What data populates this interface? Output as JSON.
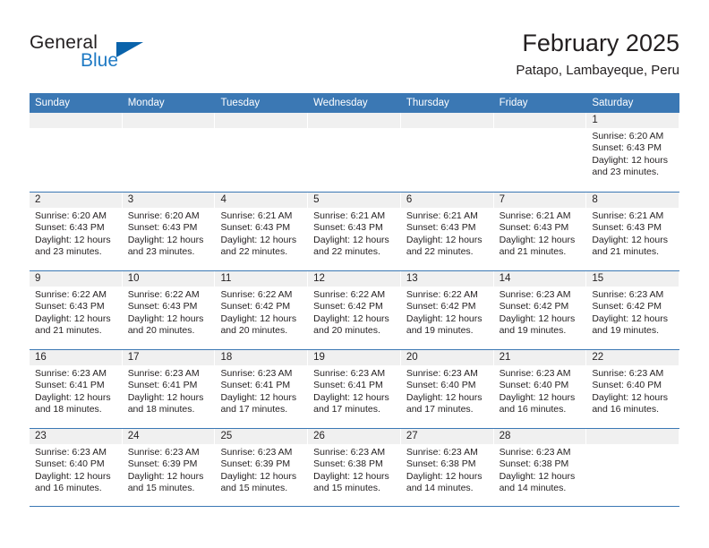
{
  "brand": {
    "name_part1": "General",
    "name_part2": "Blue",
    "accent_color": "#0a63ab",
    "blue_text_color": "#1f7ac4"
  },
  "header": {
    "title": "February 2025",
    "subtitle": "Patapo, Lambayeque, Peru"
  },
  "calendar": {
    "header_bg": "#3b78b4",
    "weekday_headers": [
      "Sunday",
      "Monday",
      "Tuesday",
      "Wednesday",
      "Thursday",
      "Friday",
      "Saturday"
    ],
    "weeks": [
      [
        {
          "day": "",
          "empty": true,
          "sunrise": "",
          "sunset": "",
          "daylight_line1": "",
          "daylight_line2": ""
        },
        {
          "day": "",
          "empty": true,
          "sunrise": "",
          "sunset": "",
          "daylight_line1": "",
          "daylight_line2": ""
        },
        {
          "day": "",
          "empty": true,
          "sunrise": "",
          "sunset": "",
          "daylight_line1": "",
          "daylight_line2": ""
        },
        {
          "day": "",
          "empty": true,
          "sunrise": "",
          "sunset": "",
          "daylight_line1": "",
          "daylight_line2": ""
        },
        {
          "day": "",
          "empty": true,
          "sunrise": "",
          "sunset": "",
          "daylight_line1": "",
          "daylight_line2": ""
        },
        {
          "day": "",
          "empty": true,
          "sunrise": "",
          "sunset": "",
          "daylight_line1": "",
          "daylight_line2": ""
        },
        {
          "day": "1",
          "sunrise": "Sunrise: 6:20 AM",
          "sunset": "Sunset: 6:43 PM",
          "daylight_line1": "Daylight: 12 hours",
          "daylight_line2": "and 23 minutes."
        }
      ],
      [
        {
          "day": "2",
          "sunrise": "Sunrise: 6:20 AM",
          "sunset": "Sunset: 6:43 PM",
          "daylight_line1": "Daylight: 12 hours",
          "daylight_line2": "and 23 minutes."
        },
        {
          "day": "3",
          "sunrise": "Sunrise: 6:20 AM",
          "sunset": "Sunset: 6:43 PM",
          "daylight_line1": "Daylight: 12 hours",
          "daylight_line2": "and 23 minutes."
        },
        {
          "day": "4",
          "sunrise": "Sunrise: 6:21 AM",
          "sunset": "Sunset: 6:43 PM",
          "daylight_line1": "Daylight: 12 hours",
          "daylight_line2": "and 22 minutes."
        },
        {
          "day": "5",
          "sunrise": "Sunrise: 6:21 AM",
          "sunset": "Sunset: 6:43 PM",
          "daylight_line1": "Daylight: 12 hours",
          "daylight_line2": "and 22 minutes."
        },
        {
          "day": "6",
          "sunrise": "Sunrise: 6:21 AM",
          "sunset": "Sunset: 6:43 PM",
          "daylight_line1": "Daylight: 12 hours",
          "daylight_line2": "and 22 minutes."
        },
        {
          "day": "7",
          "sunrise": "Sunrise: 6:21 AM",
          "sunset": "Sunset: 6:43 PM",
          "daylight_line1": "Daylight: 12 hours",
          "daylight_line2": "and 21 minutes."
        },
        {
          "day": "8",
          "sunrise": "Sunrise: 6:21 AM",
          "sunset": "Sunset: 6:43 PM",
          "daylight_line1": "Daylight: 12 hours",
          "daylight_line2": "and 21 minutes."
        }
      ],
      [
        {
          "day": "9",
          "sunrise": "Sunrise: 6:22 AM",
          "sunset": "Sunset: 6:43 PM",
          "daylight_line1": "Daylight: 12 hours",
          "daylight_line2": "and 21 minutes."
        },
        {
          "day": "10",
          "sunrise": "Sunrise: 6:22 AM",
          "sunset": "Sunset: 6:43 PM",
          "daylight_line1": "Daylight: 12 hours",
          "daylight_line2": "and 20 minutes."
        },
        {
          "day": "11",
          "sunrise": "Sunrise: 6:22 AM",
          "sunset": "Sunset: 6:42 PM",
          "daylight_line1": "Daylight: 12 hours",
          "daylight_line2": "and 20 minutes."
        },
        {
          "day": "12",
          "sunrise": "Sunrise: 6:22 AM",
          "sunset": "Sunset: 6:42 PM",
          "daylight_line1": "Daylight: 12 hours",
          "daylight_line2": "and 20 minutes."
        },
        {
          "day": "13",
          "sunrise": "Sunrise: 6:22 AM",
          "sunset": "Sunset: 6:42 PM",
          "daylight_line1": "Daylight: 12 hours",
          "daylight_line2": "and 19 minutes."
        },
        {
          "day": "14",
          "sunrise": "Sunrise: 6:23 AM",
          "sunset": "Sunset: 6:42 PM",
          "daylight_line1": "Daylight: 12 hours",
          "daylight_line2": "and 19 minutes."
        },
        {
          "day": "15",
          "sunrise": "Sunrise: 6:23 AM",
          "sunset": "Sunset: 6:42 PM",
          "daylight_line1": "Daylight: 12 hours",
          "daylight_line2": "and 19 minutes."
        }
      ],
      [
        {
          "day": "16",
          "sunrise": "Sunrise: 6:23 AM",
          "sunset": "Sunset: 6:41 PM",
          "daylight_line1": "Daylight: 12 hours",
          "daylight_line2": "and 18 minutes."
        },
        {
          "day": "17",
          "sunrise": "Sunrise: 6:23 AM",
          "sunset": "Sunset: 6:41 PM",
          "daylight_line1": "Daylight: 12 hours",
          "daylight_line2": "and 18 minutes."
        },
        {
          "day": "18",
          "sunrise": "Sunrise: 6:23 AM",
          "sunset": "Sunset: 6:41 PM",
          "daylight_line1": "Daylight: 12 hours",
          "daylight_line2": "and 17 minutes."
        },
        {
          "day": "19",
          "sunrise": "Sunrise: 6:23 AM",
          "sunset": "Sunset: 6:41 PM",
          "daylight_line1": "Daylight: 12 hours",
          "daylight_line2": "and 17 minutes."
        },
        {
          "day": "20",
          "sunrise": "Sunrise: 6:23 AM",
          "sunset": "Sunset: 6:40 PM",
          "daylight_line1": "Daylight: 12 hours",
          "daylight_line2": "and 17 minutes."
        },
        {
          "day": "21",
          "sunrise": "Sunrise: 6:23 AM",
          "sunset": "Sunset: 6:40 PM",
          "daylight_line1": "Daylight: 12 hours",
          "daylight_line2": "and 16 minutes."
        },
        {
          "day": "22",
          "sunrise": "Sunrise: 6:23 AM",
          "sunset": "Sunset: 6:40 PM",
          "daylight_line1": "Daylight: 12 hours",
          "daylight_line2": "and 16 minutes."
        }
      ],
      [
        {
          "day": "23",
          "sunrise": "Sunrise: 6:23 AM",
          "sunset": "Sunset: 6:40 PM",
          "daylight_line1": "Daylight: 12 hours",
          "daylight_line2": "and 16 minutes."
        },
        {
          "day": "24",
          "sunrise": "Sunrise: 6:23 AM",
          "sunset": "Sunset: 6:39 PM",
          "daylight_line1": "Daylight: 12 hours",
          "daylight_line2": "and 15 minutes."
        },
        {
          "day": "25",
          "sunrise": "Sunrise: 6:23 AM",
          "sunset": "Sunset: 6:39 PM",
          "daylight_line1": "Daylight: 12 hours",
          "daylight_line2": "and 15 minutes."
        },
        {
          "day": "26",
          "sunrise": "Sunrise: 6:23 AM",
          "sunset": "Sunset: 6:38 PM",
          "daylight_line1": "Daylight: 12 hours",
          "daylight_line2": "and 15 minutes."
        },
        {
          "day": "27",
          "sunrise": "Sunrise: 6:23 AM",
          "sunset": "Sunset: 6:38 PM",
          "daylight_line1": "Daylight: 12 hours",
          "daylight_line2": "and 14 minutes."
        },
        {
          "day": "28",
          "sunrise": "Sunrise: 6:23 AM",
          "sunset": "Sunset: 6:38 PM",
          "daylight_line1": "Daylight: 12 hours",
          "daylight_line2": "and 14 minutes."
        },
        {
          "day": "",
          "empty": true,
          "sunrise": "",
          "sunset": "",
          "daylight_line1": "",
          "daylight_line2": ""
        }
      ]
    ]
  }
}
